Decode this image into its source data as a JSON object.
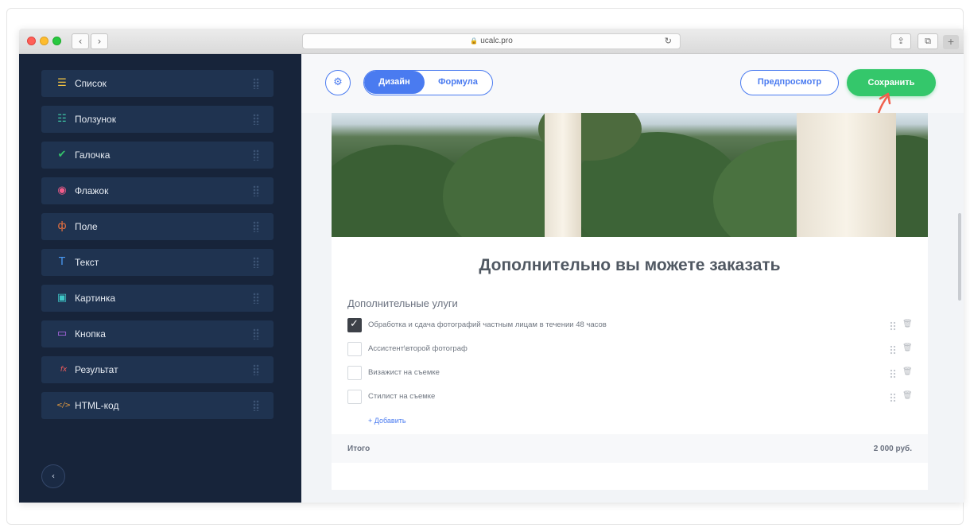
{
  "browser": {
    "url": "ucalc.pro",
    "back_glyph": "‹",
    "forward_glyph": "›",
    "reload_glyph": "↻",
    "share_glyph": "⇪",
    "tabs_glyph": "⧉",
    "newtab_glyph": "+"
  },
  "sidebar": {
    "items": [
      {
        "label": "Список",
        "icon": "list-icon",
        "glyph": "☰",
        "color": "#f5c542"
      },
      {
        "label": "Ползунок",
        "icon": "slider-icon",
        "glyph": "☷",
        "color": "#3ec7a6"
      },
      {
        "label": "Галочка",
        "icon": "checkbox-icon",
        "glyph": "✔",
        "color": "#35c26b"
      },
      {
        "label": "Флажок",
        "icon": "radio-icon",
        "glyph": "◉",
        "color": "#f25c8a"
      },
      {
        "label": "Поле",
        "icon": "field-icon",
        "glyph": "ф",
        "color": "#f0733e"
      },
      {
        "label": "Текст",
        "icon": "text-icon",
        "glyph": "T",
        "color": "#4a9af5"
      },
      {
        "label": "Картинка",
        "icon": "image-icon",
        "glyph": "▣",
        "color": "#3ec7c7"
      },
      {
        "label": "Кнопка",
        "icon": "button-icon",
        "glyph": "▭",
        "color": "#b86cf0"
      },
      {
        "label": "Результат",
        "icon": "formula-icon",
        "glyph": "fx",
        "color": "#f25c5c"
      },
      {
        "label": "HTML-код",
        "icon": "code-icon",
        "glyph": "</>",
        "color": "#f0a13e"
      }
    ],
    "collapse_glyph": "‹"
  },
  "toolbar": {
    "settings_glyph": "⚙",
    "tab_design": "Дизайн",
    "tab_formula": "Формула",
    "preview_label": "Предпросмотр",
    "save_label": "Сохранить"
  },
  "calculator": {
    "title": "Дополнительно вы можете заказать",
    "group_title": "Дополнительные улуги",
    "options": [
      {
        "label": "Обработка и сдача фотографий частным лицам в течении 48 часов",
        "checked": true
      },
      {
        "label": "Ассистент\\второй фотограф",
        "checked": false
      },
      {
        "label": "Визажист на съемке",
        "checked": false
      },
      {
        "label": "Стилист на съемке",
        "checked": false
      }
    ],
    "add_label": "+ Добавить",
    "total_label": "Итого",
    "total_value": "2 000 руб."
  },
  "colors": {
    "sidebar_bg": "#17243a",
    "accent_blue": "#4a7bf0",
    "save_green": "#34c76b",
    "arrow_red": "#f0604d"
  }
}
